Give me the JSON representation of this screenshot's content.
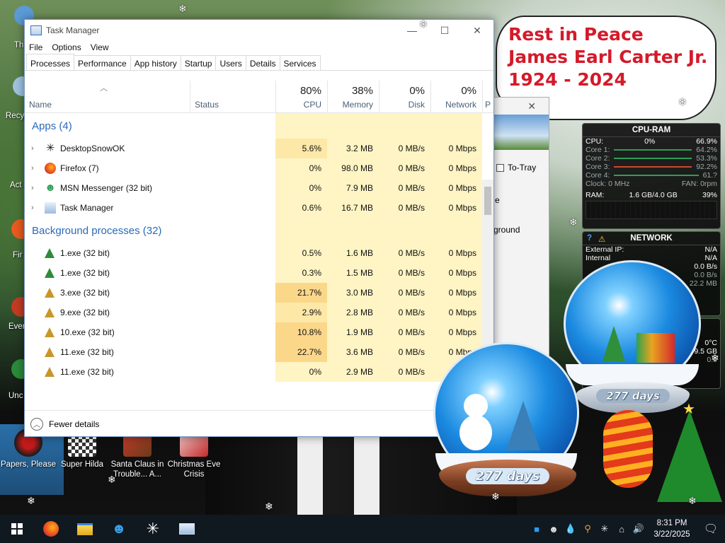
{
  "desktop": {
    "icons": [
      {
        "label": "Papers, Please"
      },
      {
        "label": "Super Hilda"
      },
      {
        "label": "Santa Claus in Trouble... A..."
      },
      {
        "label": "Christmas Eve Crisis"
      }
    ],
    "edge_labels": [
      "Th",
      "Recy",
      "Act",
      "Fir",
      "Ever",
      "Unc"
    ],
    "rip": {
      "line1": "Rest in Peace",
      "line2": "James Earl Carter Jr.",
      "line3": "1924 - 2024"
    }
  },
  "cpu_gadget": {
    "title": "CPU-RAM",
    "cpu_label": "CPU:",
    "cpu_value": "0%",
    "cpu_pct": "66.9%",
    "cores": [
      {
        "label": "Core 1:",
        "value": "64.2%"
      },
      {
        "label": "Core 2:",
        "value": "53.3%"
      },
      {
        "label": "Core 3:",
        "value": "92.2%"
      },
      {
        "label": "Core 4:",
        "value": "61.?"
      }
    ],
    "clock_label": "Clock: 0 MHz",
    "fan_label": "FAN: 0rpm",
    "ram_label": "RAM:",
    "ram_value": "1.6 GB/4.0 GB",
    "ram_pct": "39%"
  },
  "net_gadget": {
    "title": "NETWORK",
    "external_ip_label": "External IP:",
    "external_ip_value": "N/A",
    "internal_ip_label": "Internal",
    "internal_ip_value": "N/A",
    "rate1": "0.0 B/s",
    "rate2": "0.0 B/s",
    "rate3": "22.2 MB"
  },
  "side_gadget": {
    "temp": "0°C",
    "size": "9.5 GB",
    "pct": "0.0"
  },
  "globes": {
    "left_days": "277 days",
    "right_days": "277 days"
  },
  "taskmanager": {
    "title": "Task Manager",
    "menus": [
      "File",
      "Options",
      "View"
    ],
    "tabs": [
      "Processes",
      "Performance",
      "App history",
      "Startup",
      "Users",
      "Details",
      "Services"
    ],
    "columns": {
      "name": "Name",
      "status": "Status",
      "cpu_pct": "80%",
      "cpu": "CPU",
      "mem_pct": "38%",
      "mem": "Memory",
      "disk_pct": "0%",
      "disk": "Disk",
      "net_pct": "0%",
      "net": "Network",
      "next": "P"
    },
    "apps_header": "Apps (4)",
    "apps": [
      {
        "name": "DesktopSnowOK",
        "cpu": "5.6%",
        "mem": "3.2 MB",
        "disk": "0 MB/s",
        "net": "0 Mbps"
      },
      {
        "name": "Firefox (7)",
        "cpu": "0%",
        "mem": "98.0 MB",
        "disk": "0 MB/s",
        "net": "0 Mbps"
      },
      {
        "name": "MSN Messenger (32 bit)",
        "cpu": "0%",
        "mem": "7.9 MB",
        "disk": "0 MB/s",
        "net": "0 Mbps"
      },
      {
        "name": "Task Manager",
        "cpu": "0.6%",
        "mem": "16.7 MB",
        "disk": "0 MB/s",
        "net": "0 Mbps"
      }
    ],
    "bg_header": "Background processes (32)",
    "bg": [
      {
        "name": "1.exe (32 bit)",
        "cpu": "0.5%",
        "mem": "1.6 MB",
        "disk": "0 MB/s",
        "net": "0 Mbps"
      },
      {
        "name": "1.exe (32 bit)",
        "cpu": "0.3%",
        "mem": "1.5 MB",
        "disk": "0 MB/s",
        "net": "0 Mbps"
      },
      {
        "name": "3.exe (32 bit)",
        "cpu": "21.7%",
        "mem": "3.0 MB",
        "disk": "0 MB/s",
        "net": "0 Mbps"
      },
      {
        "name": "9.exe (32 bit)",
        "cpu": "2.9%",
        "mem": "2.8 MB",
        "disk": "0 MB/s",
        "net": "0 Mbps"
      },
      {
        "name": "10.exe (32 bit)",
        "cpu": "10.8%",
        "mem": "1.9 MB",
        "disk": "0 MB/s",
        "net": "0 Mbps"
      },
      {
        "name": "11.exe (32 bit)",
        "cpu": "22.7%",
        "mem": "3.6 MB",
        "disk": "0 MB/s",
        "net": "0 Mbps"
      },
      {
        "name": "11.exe (32 bit)",
        "cpu": "0%",
        "mem": "2.9 MB",
        "disk": "0 MB/s",
        "net": "0 Mbps"
      }
    ],
    "fewer_details": "Fewer details"
  },
  "bg_window": {
    "to_tray": "To-Tray",
    "partial1": "e",
    "partial2": "kground"
  },
  "taskbar": {
    "time": "8:31 PM",
    "date": "3/22/2025"
  },
  "colors": {
    "cpu_high": "#fbd78a",
    "cpu_mid": "#fde8a8",
    "cpu_low": "#fff4c4",
    "group_blue": "#2a6ab8",
    "rip_red": "#d41a2a"
  }
}
